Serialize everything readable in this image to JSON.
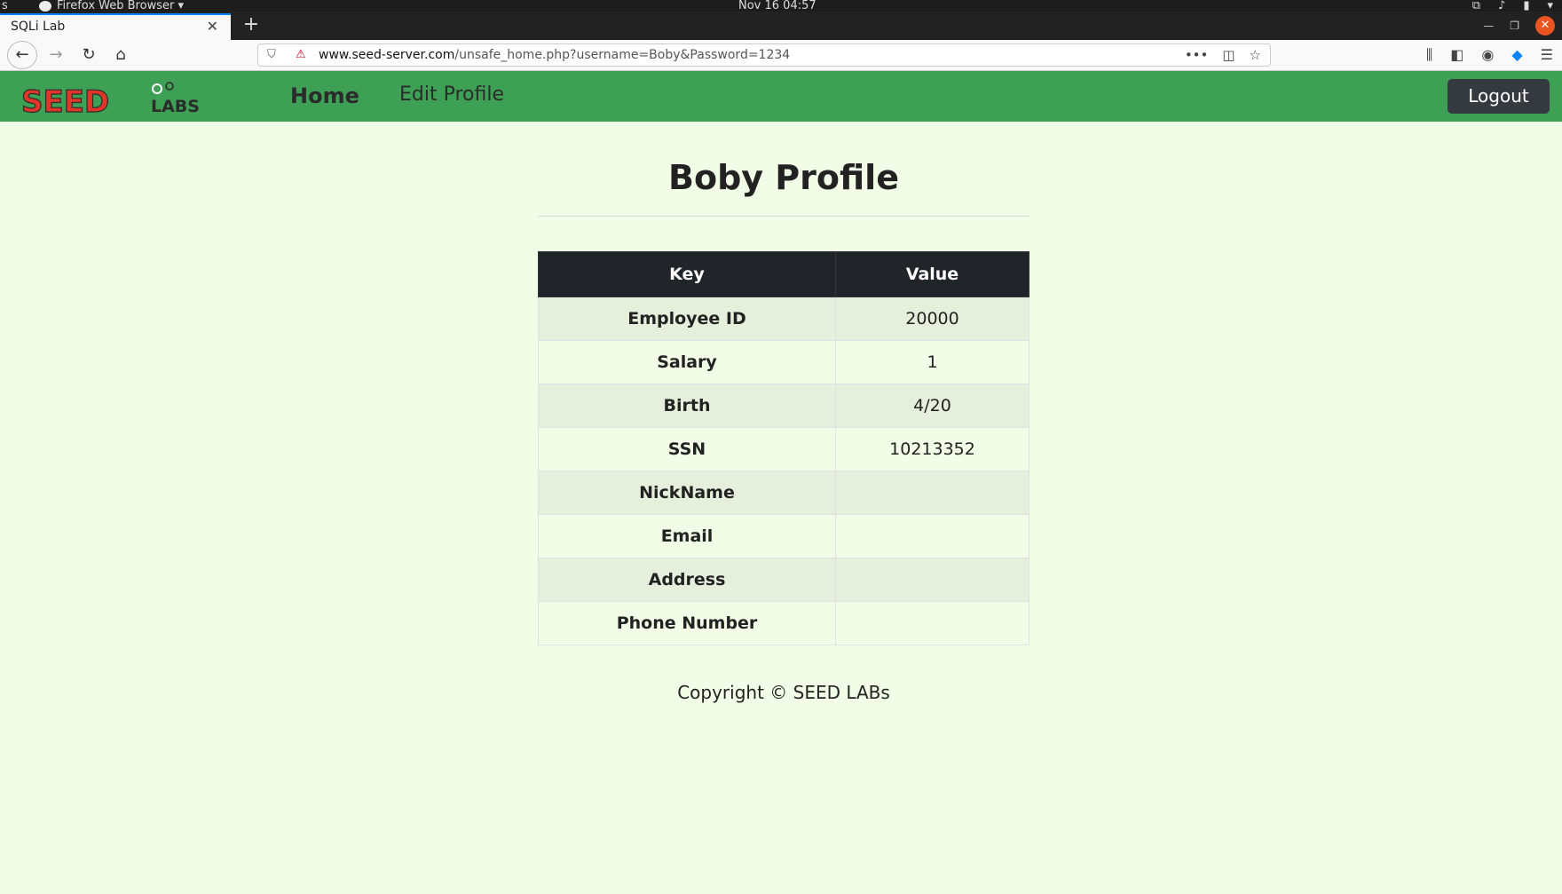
{
  "os": {
    "activities": "s",
    "app_menu": "Firefox Web Browser ▾",
    "clock": "Nov 16  04:57"
  },
  "browser": {
    "tab_title": "SQLi Lab",
    "url_domain": "www.seed-server.com",
    "url_path": "/unsafe_home.php?username=Boby&Password=1234"
  },
  "site": {
    "logo_text_main": "SEED",
    "logo_text_sub": "LABS",
    "nav_home": "Home",
    "nav_edit": "Edit Profile",
    "logout": "Logout"
  },
  "profile": {
    "title": "Boby Profile",
    "header_key": "Key",
    "header_value": "Value",
    "rows": [
      {
        "key": "Employee ID",
        "value": "20000"
      },
      {
        "key": "Salary",
        "value": "1"
      },
      {
        "key": "Birth",
        "value": "4/20"
      },
      {
        "key": "SSN",
        "value": "10213352"
      },
      {
        "key": "NickName",
        "value": ""
      },
      {
        "key": "Email",
        "value": ""
      },
      {
        "key": "Address",
        "value": ""
      },
      {
        "key": "Phone Number",
        "value": ""
      }
    ]
  },
  "footer": {
    "copyright": "Copyright © SEED LABs"
  },
  "colors": {
    "navbar": "#3ea055",
    "page_bg": "#f1fde6",
    "table_header": "#212529",
    "logout_bg": "#343a40"
  }
}
